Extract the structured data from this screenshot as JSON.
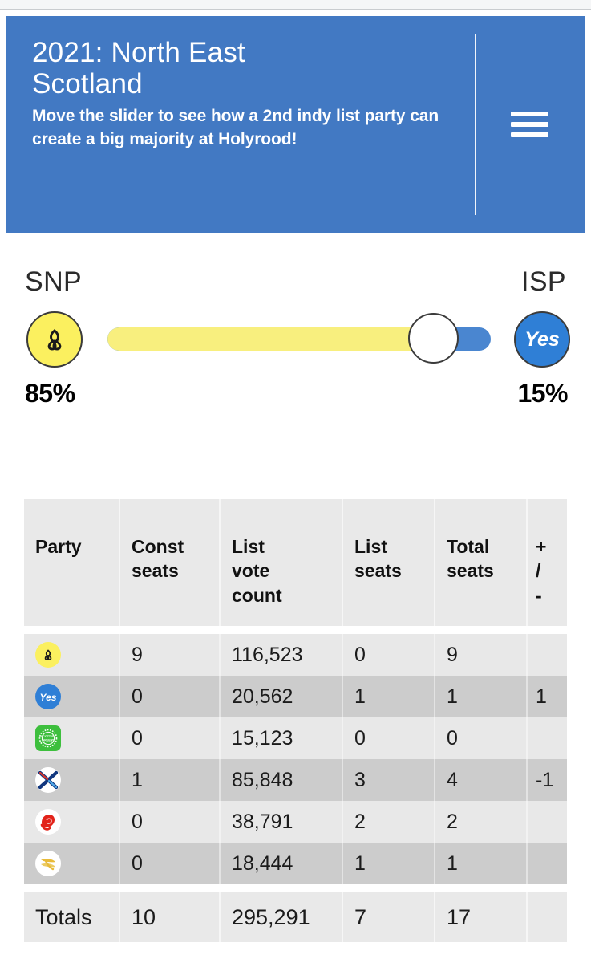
{
  "header": {
    "title": "2021: North East\nScotland",
    "subtitle": "Move the slider to see how a 2nd indy list party can create a big majority at Holyrood!",
    "menu_icon": "hamburger-menu-icon",
    "background_color": "#4279c3"
  },
  "slider": {
    "left_label": "SNP",
    "right_label": "ISP",
    "left_percent": "85%",
    "right_percent": "15%",
    "left_value": 85,
    "right_value": 15,
    "left_logo": "snp-thistle-icon",
    "right_logo": "isp-yes-icon",
    "fill_color": "#f8ef7e",
    "track_color": "#4a86d0"
  },
  "table": {
    "headers": [
      "Party",
      "Const\nseats",
      "List\nvote\ncount",
      "List\nseats",
      "Total\nseats",
      "+\n/\n-"
    ],
    "rows": [
      {
        "logo": "snp-thistle-icon",
        "party": "SNP",
        "const_seats": "9",
        "list_votes": "116,523",
        "list_seats": "0",
        "total_seats": "9",
        "change": "",
        "change_sign": ""
      },
      {
        "logo": "isp-yes-icon",
        "party": "ISP",
        "const_seats": "0",
        "list_votes": "20,562",
        "list_seats": "1",
        "total_seats": "1",
        "change": "1",
        "change_sign": "pos"
      },
      {
        "logo": "greens-icon",
        "party": "Scottish Greens",
        "const_seats": "0",
        "list_votes": "15,123",
        "list_seats": "0",
        "total_seats": "0",
        "change": "",
        "change_sign": ""
      },
      {
        "logo": "conservative-icon",
        "party": "Conservative",
        "const_seats": "1",
        "list_votes": "85,848",
        "list_seats": "3",
        "total_seats": "4",
        "change": "-1",
        "change_sign": "neg"
      },
      {
        "logo": "labour-rose-icon",
        "party": "Labour",
        "const_seats": "0",
        "list_votes": "38,791",
        "list_seats": "2",
        "total_seats": "2",
        "change": "",
        "change_sign": ""
      },
      {
        "logo": "libdem-bird-icon",
        "party": "Liberal Democrats",
        "const_seats": "0",
        "list_votes": "18,444",
        "list_seats": "1",
        "total_seats": "1",
        "change": "",
        "change_sign": ""
      }
    ],
    "totals": {
      "label": "Totals",
      "const_seats": "10",
      "list_votes": "295,291",
      "list_seats": "7",
      "total_seats": "17",
      "change": ""
    },
    "colors": {
      "header_bg": "#e9e9e9",
      "row_odd": "#e8e8e8",
      "row_even": "#cccccc",
      "positive": "#1c8a2e",
      "negative": "#f0402a"
    }
  }
}
